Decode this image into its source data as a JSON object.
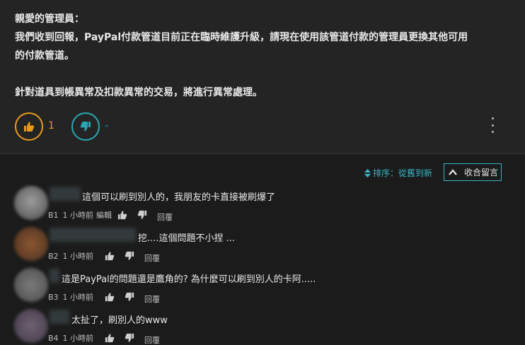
{
  "post": {
    "greeting": "親愛的管理員：",
    "line1": "我們收到回報，PayPal付款管道目前正在臨時維護升級，請現在使用該管道付款的管理員更換其他可用",
    "line2": "的付款管道。",
    "line3": "針對道具到帳異常及扣款異常的交易，將進行異常處理。",
    "upvotes": "1",
    "downvotes": "-",
    "up_color": "#e89a1c",
    "down_color": "#2aa7b4"
  },
  "comments_bar": {
    "sort_label": "排序：從舊到新",
    "collapse_label": "收合留言"
  },
  "comments": [
    {
      "text": "這個可以刷到別人的，我朋友的卡直接被刷爆了",
      "floor": "B1",
      "time": "1 小時前",
      "edited": "編輯",
      "reply": "回覆"
    },
    {
      "text": "挖....這個問題不小捏 ...",
      "floor": "B2",
      "time": "1 小時前",
      "edited": "",
      "reply": "回覆"
    },
    {
      "text": "這是PayPal的問題還是鷹角的? 為什麼可以刷到別人的卡阿.....",
      "floor": "B3",
      "time": "1 小時前",
      "edited": "",
      "reply": "回覆"
    },
    {
      "text": "太扯了，刷別人的www",
      "floor": "B4",
      "time": "1 小時前",
      "edited": "",
      "reply": "回覆"
    }
  ]
}
